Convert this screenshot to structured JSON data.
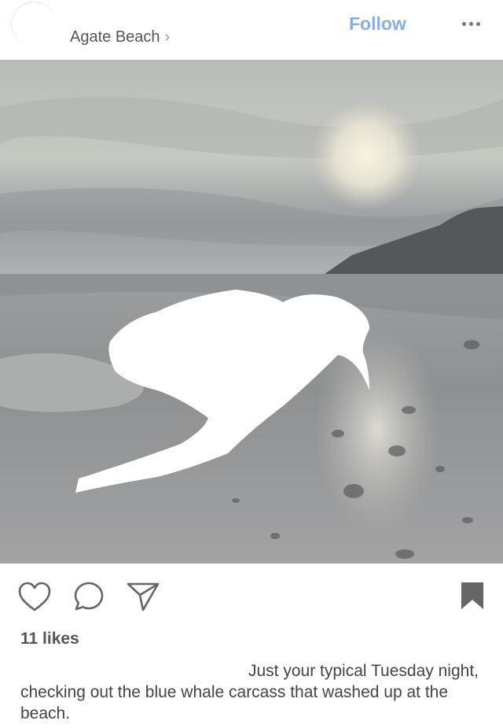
{
  "header": {
    "location": "Agate Beach",
    "follow_label": "Follow",
    "more_icon": "more-dots-icon"
  },
  "post": {
    "likes": "11 likes",
    "caption": "Just your typical Tuesday night, checking out the blue whale carcass that washed up at the beach."
  },
  "actions": {
    "like_icon": "heart-icon",
    "comment_icon": "comment-icon",
    "share_icon": "share-icon",
    "save_icon": "bookmark-icon"
  },
  "colors": {
    "follow": "#86aee8",
    "icon": "#666666"
  }
}
